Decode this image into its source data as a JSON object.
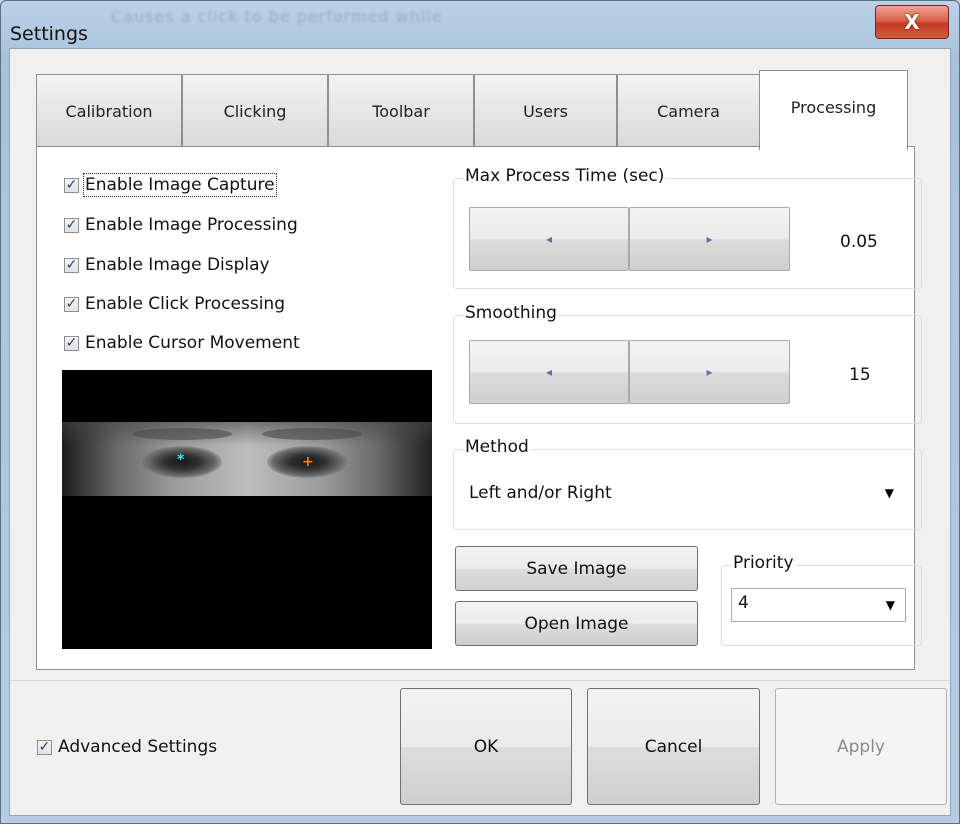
{
  "window": {
    "title": "Settings",
    "ghost_title": "Causes a click to be performed while",
    "close_glyph": "X"
  },
  "tabs": [
    {
      "label": "Calibration"
    },
    {
      "label": "Clicking"
    },
    {
      "label": "Toolbar"
    },
    {
      "label": "Users"
    },
    {
      "label": "Camera"
    },
    {
      "label": "Processing",
      "active": true
    }
  ],
  "checkboxes": [
    {
      "label": "Enable Image Capture",
      "checked": true
    },
    {
      "label": "Enable Image Processing",
      "checked": true
    },
    {
      "label": "Enable Image Display",
      "checked": true
    },
    {
      "label": "Enable Click Processing",
      "checked": true
    },
    {
      "label": "Enable Cursor Movement",
      "checked": true
    }
  ],
  "check_glyph": "✓",
  "max_process_time": {
    "legend": "Max Process Time (sec)",
    "value": "0.05"
  },
  "smoothing": {
    "legend": "Smoothing",
    "value": "15"
  },
  "method": {
    "legend": "Method",
    "selected": "Left and/or Right"
  },
  "priority": {
    "legend": "Priority",
    "selected": "4"
  },
  "buttons": {
    "save_image": "Save Image",
    "open_image": "Open Image",
    "ok": "OK",
    "cancel": "Cancel",
    "apply": "Apply"
  },
  "advanced": {
    "label": "Advanced Settings",
    "checked": true
  },
  "icons": {
    "spin_left": "◂",
    "spin_right": "▸",
    "dropdown": "▼",
    "left_eye_marker": "*",
    "right_eye_marker": "+"
  },
  "colors": {
    "left_eye_marker": "#35e6ef",
    "right_eye_marker": "#ff7a1a",
    "close_button": "#c53b23"
  }
}
